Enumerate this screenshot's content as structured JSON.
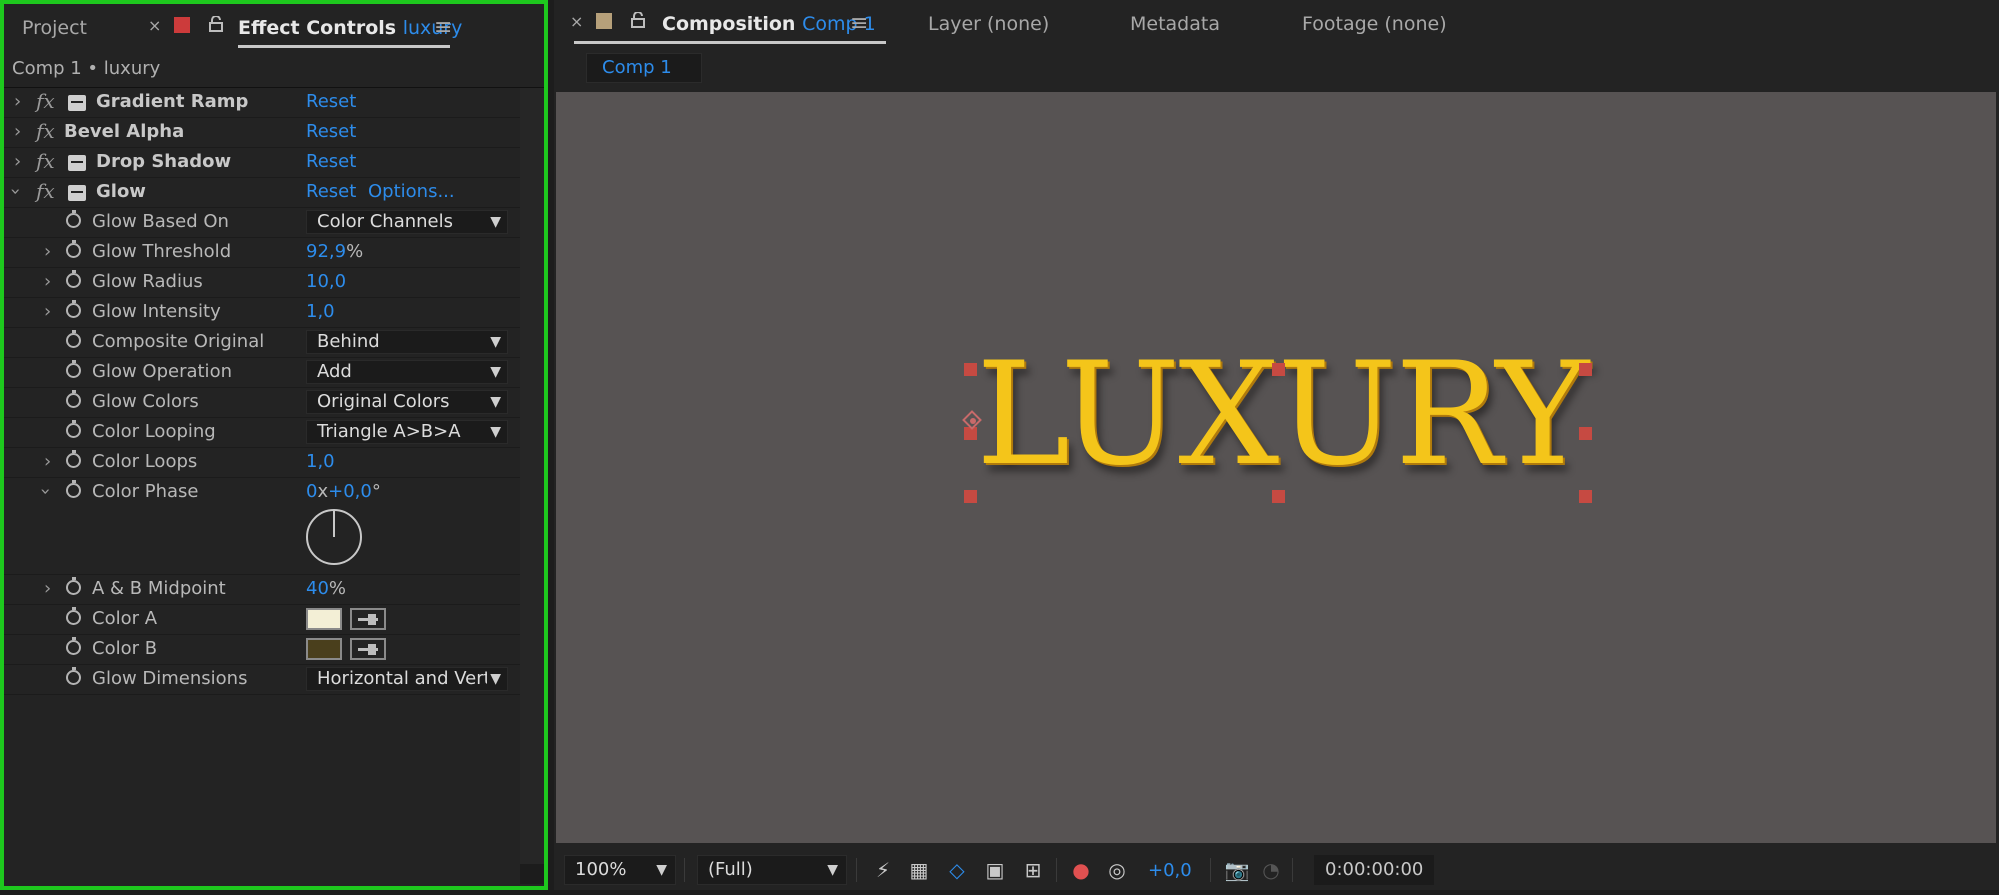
{
  "left_panel": {
    "tabs": {
      "project": "Project",
      "close": "×",
      "effect_controls_prefix": "Effect Controls",
      "effect_controls_layer": "luxury",
      "menu": "≡"
    },
    "breadcrumb": "Comp 1 • luxury",
    "effects": {
      "gradient_ramp": {
        "name": "Gradient Ramp",
        "reset": "Reset"
      },
      "bevel_alpha": {
        "name": "Bevel Alpha",
        "reset": "Reset"
      },
      "drop_shadow": {
        "name": "Drop Shadow",
        "reset": "Reset"
      },
      "glow": {
        "name": "Glow",
        "reset": "Reset",
        "options": "Options..."
      }
    },
    "fx_glyph": "fx",
    "glow_props": {
      "based_on": {
        "label": "Glow Based On",
        "value": "Color Channels"
      },
      "threshold": {
        "label": "Glow Threshold",
        "value": "92,9",
        "unit": "%"
      },
      "radius": {
        "label": "Glow Radius",
        "value": "10,0"
      },
      "intensity": {
        "label": "Glow Intensity",
        "value": "1,0"
      },
      "composite": {
        "label": "Composite Original",
        "value": "Behind"
      },
      "operation": {
        "label": "Glow Operation",
        "value": "Add"
      },
      "colors": {
        "label": "Glow Colors",
        "value": "Original Colors"
      },
      "looping": {
        "label": "Color Looping",
        "value": "Triangle A>B>A"
      },
      "loops": {
        "label": "Color Loops",
        "value": "1,0"
      },
      "phase": {
        "label": "Color Phase",
        "rev": "0",
        "x": "x",
        "deg": "+0,0",
        "deg_unit": "°"
      },
      "midpoint": {
        "label": "A & B Midpoint",
        "value": "40",
        "unit": "%"
      },
      "color_a": {
        "label": "Color A",
        "color": "#f3efd6"
      },
      "color_b": {
        "label": "Color B",
        "color": "#4a3f1c"
      },
      "dimensions": {
        "label": "Glow Dimensions",
        "value": "Horizontal and Verti"
      }
    }
  },
  "right_panel": {
    "tabs": {
      "close": "×",
      "composition_prefix": "Composition",
      "composition_name": "Comp 1",
      "menu": "≡",
      "layer": "Layer (none)",
      "metadata": "Metadata",
      "footage": "Footage (none)"
    },
    "subtab": "Comp 1",
    "canvas_text": "LUXURY",
    "bottom": {
      "zoom": "100%",
      "resolution": "(Full)",
      "exposure": "+0,0",
      "timecode": "0:00:00:00"
    }
  },
  "colors": {
    "accent": "#2d8ceb",
    "selection_outline": "#1ec81e",
    "text_gold": "#f4c51a",
    "handle": "#c64a42",
    "viewer_bg": "#575353"
  },
  "icons": [
    "chevron-right-icon",
    "chevron-down-icon",
    "fx-icon",
    "stopwatch-icon",
    "lock-icon",
    "eyedropper-icon",
    "camera-icon",
    "dropdown-arrow-icon"
  ]
}
